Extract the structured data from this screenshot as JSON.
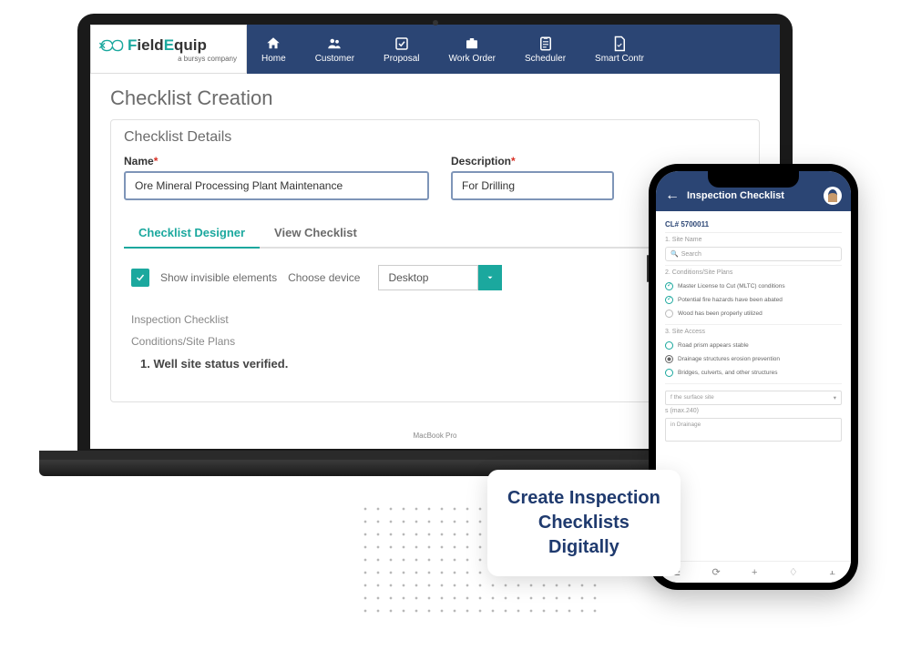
{
  "logo": {
    "brand": "FieldEquip",
    "tagline": "a bursys company"
  },
  "nav": [
    {
      "label": "Home"
    },
    {
      "label": "Customer"
    },
    {
      "label": "Proposal"
    },
    {
      "label": "Work Order"
    },
    {
      "label": "Scheduler"
    },
    {
      "label": "Smart Contr"
    }
  ],
  "page": {
    "title": "Checklist Creation",
    "panel_title": "Checklist Details",
    "fields": {
      "name_label": "Name",
      "name_value": "Ore Mineral Processing Plant Maintenance",
      "desc_label": "Description",
      "desc_value": "For Drilling"
    },
    "tabs": {
      "designer": "Checklist Designer",
      "view": "View Checklist"
    },
    "designer": {
      "show_invisible": "Show invisible elements",
      "choose_device": "Choose device",
      "device_value": "Desktop",
      "preview": {
        "l1": "Inspection Checklist",
        "l2": "Conditions/Site Plans",
        "l3": "1. Well site status verified."
      }
    }
  },
  "phone": {
    "title": "Inspection Checklist",
    "cl": "CL# 5700011",
    "s1": {
      "title": "1. Site Name",
      "search": "Search"
    },
    "s2": {
      "title": "2. Conditions/Site Plans",
      "items": [
        "Master License to Cut (MLTC) conditions",
        "Potential fire hazards have been abated",
        "Wood has been properly utilized"
      ]
    },
    "s3": {
      "title": "3. Site Access",
      "items": [
        "Road prism appears stable",
        "Drainage structures erosion prevention",
        "Bridges, culverts, and other structures"
      ]
    },
    "s4": {
      "dropdown": "f the surface site",
      "f1": "s (max.240)",
      "f2": "in Drainage"
    }
  },
  "caption": {
    "l1": "Create Inspection",
    "l2": "Checklists",
    "l3": "Digitally"
  }
}
